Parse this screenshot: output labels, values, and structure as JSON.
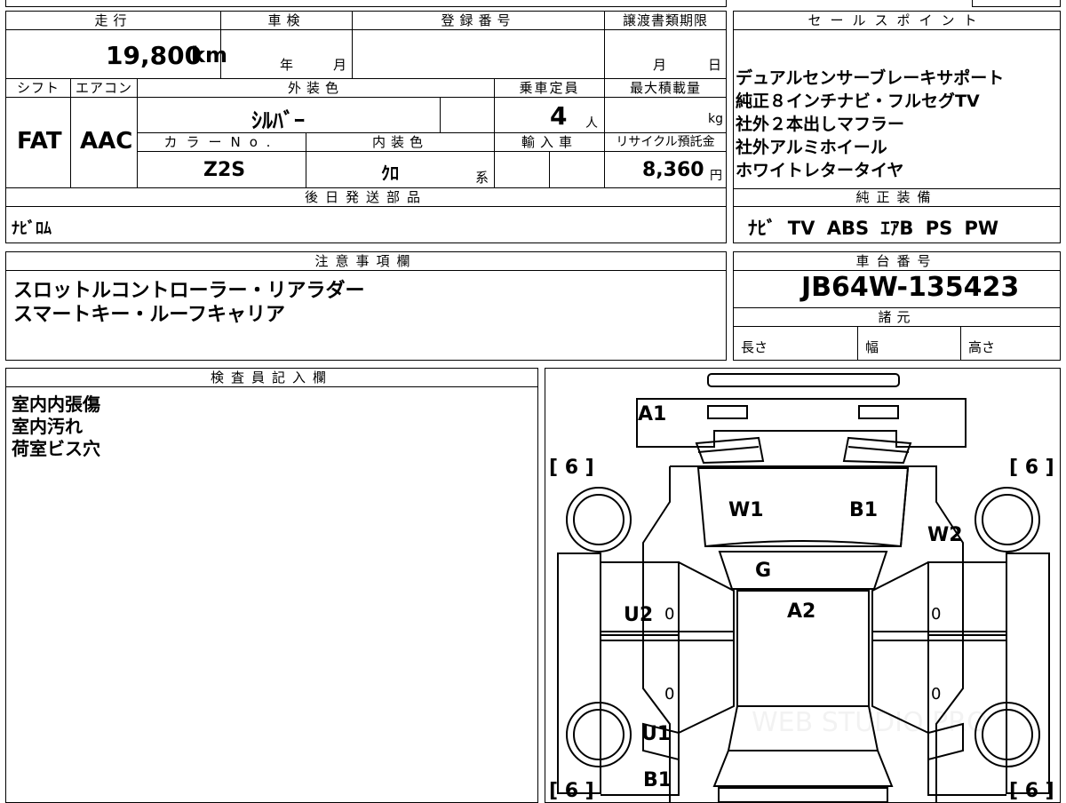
{
  "top_table": {
    "headers": {
      "mileage": "走行",
      "inspection": "車検",
      "registration": "登録番号",
      "transfer_deadline": "譲渡書類期限",
      "shift": "シフト",
      "aircon": "エアコン",
      "exterior_color": "外装色",
      "capacity": "乗車定員",
      "max_load": "最大積載量",
      "color_no": "カラーNo.",
      "interior_color": "内装色",
      "import": "輸入車",
      "recycle": "リサイクル預託金",
      "parts": "後日発送部品"
    },
    "mileage_value": "19,800",
    "mileage_unit": "km",
    "year_label": "年",
    "month_label": "月",
    "transfer_month": "月",
    "transfer_day": "日",
    "shift_value": "FAT",
    "aircon_value": "AAC",
    "exterior_color_value": "ｼﾙﾊﾞｰ",
    "capacity_value": "4",
    "capacity_unit": "人",
    "max_load_unit": "kg",
    "color_no_value": "Z2S",
    "interior_color_value": "ｸﾛ",
    "interior_suffix": "系",
    "recycle_value": "8,360",
    "recycle_unit": "円",
    "parts_value": "ﾅﾋﾞﾛﾑ"
  },
  "sales_points": {
    "header": "セールスポイント",
    "lines": [
      "デュアルセンサーブレーキサポート",
      "純正８インチナビ・フルセグTV",
      "社外２本出しマフラー",
      "社外アルミホイール",
      "ホワイトレタータイヤ"
    ]
  },
  "standard_equipment": {
    "header": "純正装備",
    "value": "ﾅﾋﾞ TV ABS ｴｱB PS PW"
  },
  "notes": {
    "header": "注意事項欄",
    "lines": [
      "スロットルコントローラー・リアラダー",
      "スマートキー・ルーフキャリア"
    ]
  },
  "chassis": {
    "header": "車台番号",
    "value": "JB64W-135423"
  },
  "specs": {
    "header": "諸元",
    "length": "長さ",
    "width": "幅",
    "height": "高さ"
  },
  "inspector": {
    "header": "検査員記入欄",
    "lines": [
      "室内内張傷",
      "室内汚れ",
      "荷室ビス穴"
    ]
  },
  "diagram": {
    "labels": {
      "a1": "A1",
      "w1": "W1",
      "b1_top": "B1",
      "w2": "W2",
      "g": "G",
      "a2": "A2",
      "u2": "U2",
      "u1": "U1",
      "b1_bottom": "B1",
      "zero": "0",
      "tire_tl": "[ 6 ]",
      "tire_tr": "[ 6 ]",
      "tire_bl": "[ 6 ]",
      "tire_br": "[ 6 ]"
    },
    "watermark": "WEB STUDIO PRO"
  }
}
